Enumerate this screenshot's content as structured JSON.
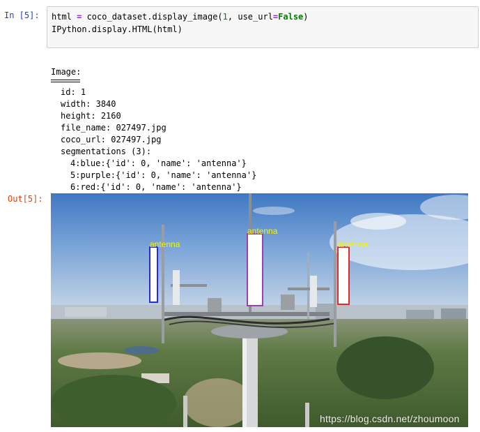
{
  "cell": {
    "in_prompt": "In  [5]:",
    "out_prompt": "Out[5]:",
    "code": {
      "line1": {
        "a": "html ",
        "op": "=",
        "b": " coco_dataset.display_image(",
        "num": "1",
        "c": ", use_url",
        "op2": "=",
        "kw": "False",
        "d": ")"
      },
      "line2": "IPython.display.HTML(html)"
    }
  },
  "output_text": {
    "heading": "Image:",
    "fields": [
      {
        "label": "id:",
        "value": "1"
      },
      {
        "label": "width:",
        "value": "3840"
      },
      {
        "label": "height:",
        "value": "2160"
      },
      {
        "label": "file_name:",
        "value": "027497.jpg"
      },
      {
        "label": "coco_url:",
        "value": "027497.jpg"
      }
    ],
    "segmentations_header": "segmentations (3):",
    "segmentations": [
      "4:blue:{'id': 0, 'name': 'antenna'}",
      "5:purple:{'id': 0, 'name': 'antenna'}",
      "6:red:{'id': 0, 'name': 'antenna'}"
    ]
  },
  "image": {
    "annotations": [
      {
        "label": "antenna",
        "color": "#2b2bd6"
      },
      {
        "label": "antenna",
        "color": "#9c3fb0"
      },
      {
        "label": "antenna",
        "color": "#e02a2a"
      }
    ],
    "label_color": "#f5f500",
    "watermark": "https://blog.csdn.net/zhoumoon"
  }
}
